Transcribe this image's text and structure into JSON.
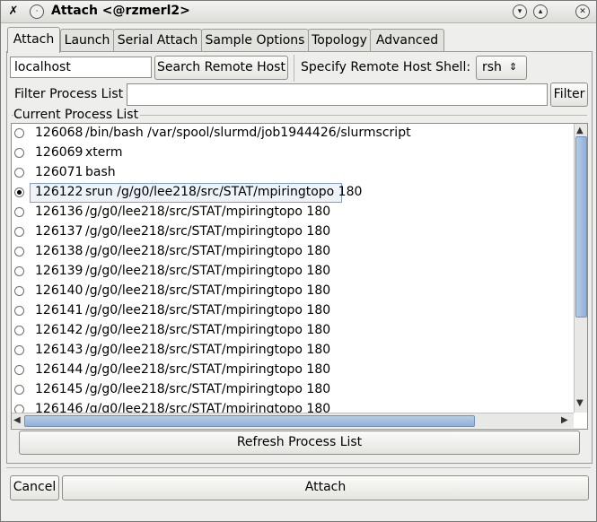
{
  "window": {
    "title": "Attach <@rzmerl2>"
  },
  "tabs": [
    "Attach",
    "Launch",
    "Serial Attach",
    "Sample Options",
    "Topology",
    "Advanced"
  ],
  "host": {
    "value": "localhost",
    "search_button": "Search Remote Host",
    "shell_label": "Specify Remote Host Shell:",
    "shell_value": "rsh"
  },
  "filter": {
    "label": "Filter Process List",
    "value": "",
    "button": "Filter"
  },
  "process_list": {
    "title": "Current Process List",
    "selected_index": 3,
    "rows": [
      {
        "pid": "126068",
        "cmd": "/bin/bash /var/spool/slurmd/job1944426/slurmscript"
      },
      {
        "pid": "126069",
        "cmd": "xterm"
      },
      {
        "pid": "126071",
        "cmd": "bash"
      },
      {
        "pid": "126122",
        "cmd": "srun /g/g0/lee218/src/STAT/mpiringtopo 180"
      },
      {
        "pid": "126136",
        "cmd": "/g/g0/lee218/src/STAT/mpiringtopo 180"
      },
      {
        "pid": "126137",
        "cmd": "/g/g0/lee218/src/STAT/mpiringtopo 180"
      },
      {
        "pid": "126138",
        "cmd": "/g/g0/lee218/src/STAT/mpiringtopo 180"
      },
      {
        "pid": "126139",
        "cmd": "/g/g0/lee218/src/STAT/mpiringtopo 180"
      },
      {
        "pid": "126140",
        "cmd": "/g/g0/lee218/src/STAT/mpiringtopo 180"
      },
      {
        "pid": "126141",
        "cmd": "/g/g0/lee218/src/STAT/mpiringtopo 180"
      },
      {
        "pid": "126142",
        "cmd": "/g/g0/lee218/src/STAT/mpiringtopo 180"
      },
      {
        "pid": "126143",
        "cmd": "/g/g0/lee218/src/STAT/mpiringtopo 180"
      },
      {
        "pid": "126144",
        "cmd": "/g/g0/lee218/src/STAT/mpiringtopo 180"
      },
      {
        "pid": "126145",
        "cmd": "/g/g0/lee218/src/STAT/mpiringtopo 180"
      },
      {
        "pid": "126146",
        "cmd": "/g/g0/lee218/src/STAT/mpiringtopo 180"
      }
    ],
    "refresh_button": "Refresh Process List"
  },
  "footer": {
    "cancel": "Cancel",
    "attach": "Attach"
  },
  "icons": {
    "app": "x-icon",
    "menu": "circle-menu-icon",
    "minimize": "chevron-down-icon",
    "maximize": "chevron-up-icon",
    "close": "close-icon"
  }
}
